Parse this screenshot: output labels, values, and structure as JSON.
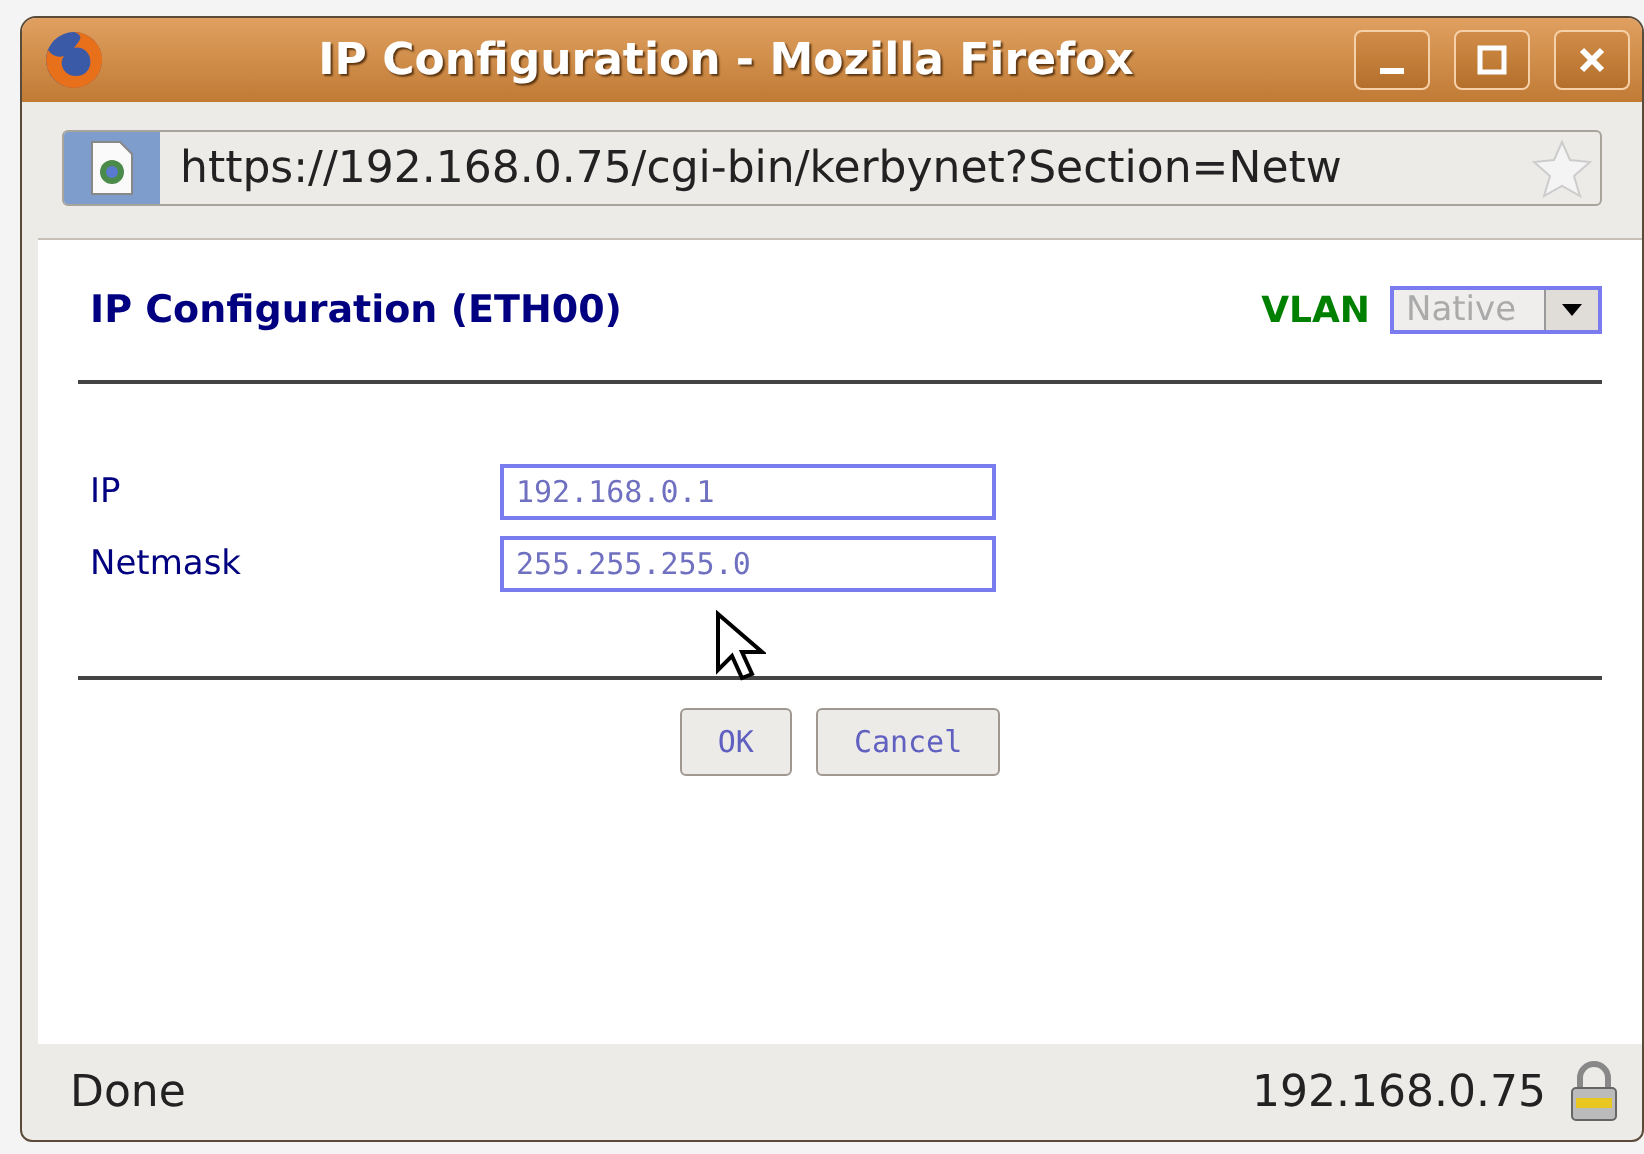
{
  "window": {
    "title": "IP Configuration - Mozilla Firefox"
  },
  "address_bar": {
    "url": "https://192.168.0.75/cgi-bin/kerbynet?Section=Netw"
  },
  "page": {
    "heading": "IP Configuration (ETH00)",
    "vlan": {
      "label": "VLAN",
      "value": "Native",
      "disabled": true
    },
    "fields": [
      {
        "label": "IP",
        "value": "192.168.0.1"
      },
      {
        "label": "Netmask",
        "value": "255.255.255.0"
      }
    ],
    "buttons": [
      "OK",
      "Cancel"
    ]
  },
  "status_bar": {
    "text": "Done",
    "host": "192.168.0.75"
  }
}
